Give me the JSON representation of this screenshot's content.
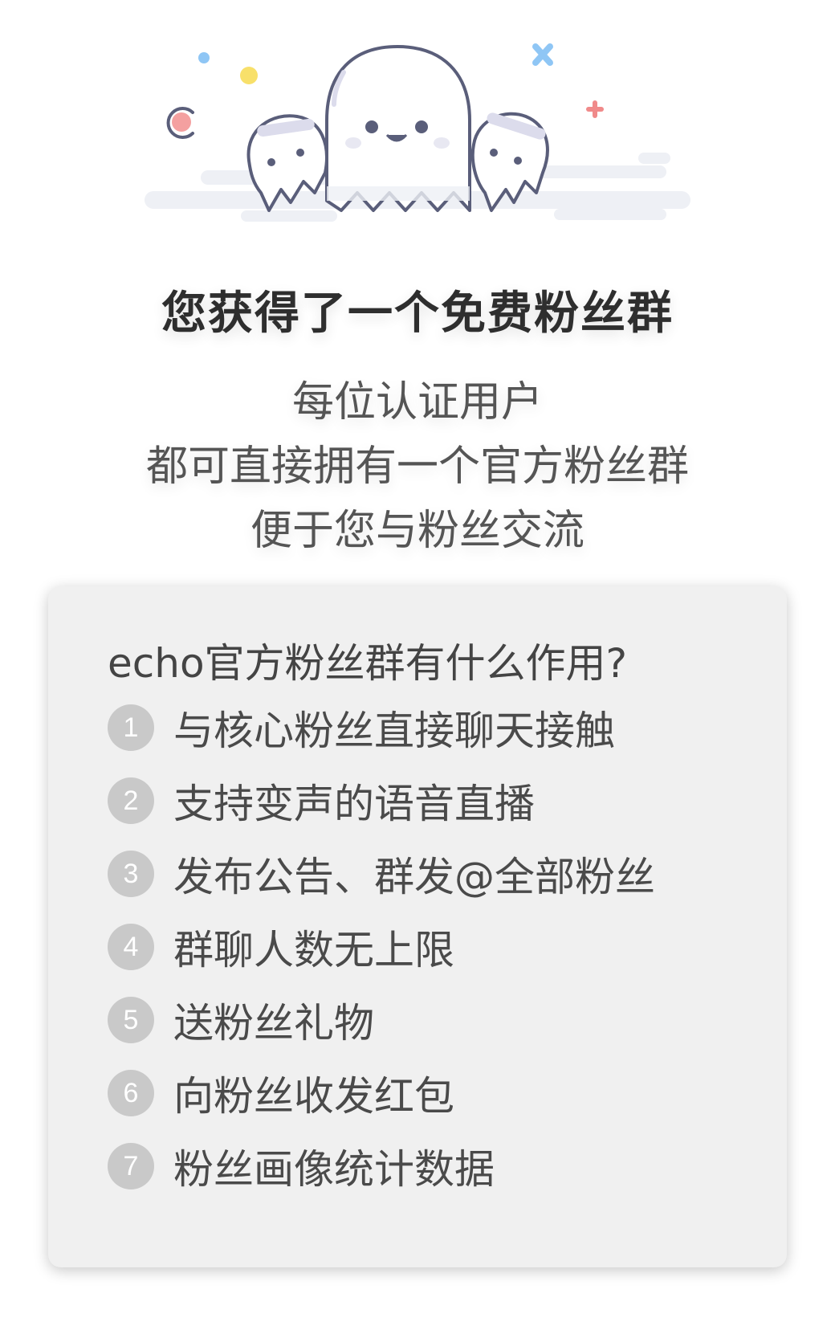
{
  "headline": "您获得了一个免费粉丝群",
  "subtitle": {
    "line1": "每位认证用户",
    "line2": "都可直接拥有一个官方粉丝群",
    "line3": "便于您与粉丝交流"
  },
  "card": {
    "title": "echo官方粉丝群有什么作用?",
    "features": [
      {
        "num": "1",
        "text": "与核心粉丝直接聊天接触"
      },
      {
        "num": "2",
        "text": "支持变声的语音直播"
      },
      {
        "num": "3",
        "text": "发布公告、群发@全部粉丝"
      },
      {
        "num": "4",
        "text": "群聊人数无上限"
      },
      {
        "num": "5",
        "text": "送粉丝礼物"
      },
      {
        "num": "6",
        "text": "向粉丝收发红包"
      },
      {
        "num": "7",
        "text": "粉丝画像统计数据"
      }
    ]
  },
  "colors": {
    "headline": "#2e2e2e",
    "card_bg": "#f0f0f0",
    "badge": "#c9c9c9",
    "ghost_outline": "#5a5e7a"
  },
  "icons": [
    "ghost-group-illustration",
    "sparkle-dot-icon",
    "cross-sparkle-icon",
    "crescent-planet-icon"
  ]
}
